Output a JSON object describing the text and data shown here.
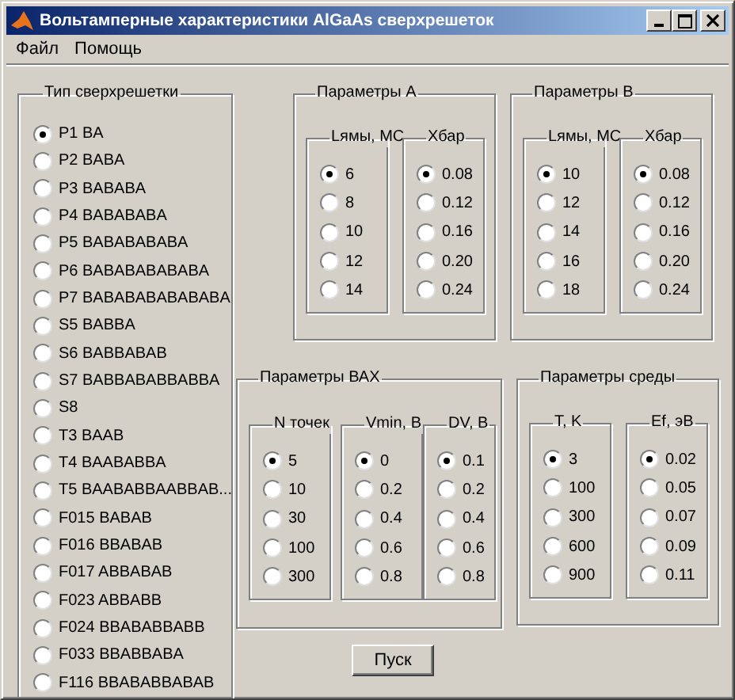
{
  "window": {
    "title": "Вольтамперные характеристики AlGaAs сверхрешеток"
  },
  "menu": [
    "Файл",
    "Помощь"
  ],
  "superlattice_type": {
    "title": "Тип сверхрешетки",
    "options": [
      {
        "label": "P1 BA",
        "selected": true
      },
      {
        "label": "P2 BABA",
        "selected": false
      },
      {
        "label": "P3 BABABA",
        "selected": false
      },
      {
        "label": "P4 BABABABA",
        "selected": false
      },
      {
        "label": "P5 BABABABABA",
        "selected": false
      },
      {
        "label": "P6 BABABABABABA",
        "selected": false
      },
      {
        "label": "P7 BABABABABABABA",
        "selected": false
      },
      {
        "label": "S5 BABBA",
        "selected": false
      },
      {
        "label": "S6 BABBABAB",
        "selected": false
      },
      {
        "label": "S7 BABBABABBABBA",
        "selected": false
      },
      {
        "label": "S8",
        "selected": false
      },
      {
        "label": "T3 BAAB",
        "selected": false
      },
      {
        "label": "T4 BAABABBA",
        "selected": false
      },
      {
        "label": "T5 BAABABBAABBAB...",
        "selected": false
      },
      {
        "label": "F015 BABAB",
        "selected": false
      },
      {
        "label": "F016 BBABAB",
        "selected": false
      },
      {
        "label": "F017 ABBABAB",
        "selected": false
      },
      {
        "label": "F023 ABBABB",
        "selected": false
      },
      {
        "label": "F024 BBABABBABB",
        "selected": false
      },
      {
        "label": "F033 BBABBABA",
        "selected": false
      },
      {
        "label": "F116 BBABABBABAB",
        "selected": false
      }
    ]
  },
  "groups": [
    {
      "title": "Параметры A",
      "columns": [
        {
          "title": "Lямы, MC",
          "options": [
            {
              "label": "6",
              "selected": true
            },
            {
              "label": "8",
              "selected": false
            },
            {
              "label": "10",
              "selected": false
            },
            {
              "label": "12",
              "selected": false
            },
            {
              "label": "14",
              "selected": false
            }
          ]
        },
        {
          "title": "Xбар",
          "options": [
            {
              "label": "0.08",
              "selected": true
            },
            {
              "label": "0.12",
              "selected": false
            },
            {
              "label": "0.16",
              "selected": false
            },
            {
              "label": "0.20",
              "selected": false
            },
            {
              "label": "0.24",
              "selected": false
            }
          ]
        }
      ]
    },
    {
      "title": "Параметры B",
      "columns": [
        {
          "title": "Lямы, MC",
          "options": [
            {
              "label": "10",
              "selected": true
            },
            {
              "label": "12",
              "selected": false
            },
            {
              "label": "14",
              "selected": false
            },
            {
              "label": "16",
              "selected": false
            },
            {
              "label": "18",
              "selected": false
            }
          ]
        },
        {
          "title": "Xбар",
          "options": [
            {
              "label": "0.08",
              "selected": true
            },
            {
              "label": "0.12",
              "selected": false
            },
            {
              "label": "0.16",
              "selected": false
            },
            {
              "label": "0.20",
              "selected": false
            },
            {
              "label": "0.24",
              "selected": false
            }
          ]
        }
      ]
    },
    {
      "title": "Параметры ВАХ",
      "columns": [
        {
          "title": "N точек",
          "options": [
            {
              "label": "5",
              "selected": true
            },
            {
              "label": "10",
              "selected": false
            },
            {
              "label": "30",
              "selected": false
            },
            {
              "label": "100",
              "selected": false
            },
            {
              "label": "300",
              "selected": false
            }
          ]
        },
        {
          "title": "Vmin, B",
          "options": [
            {
              "label": "0",
              "selected": true
            },
            {
              "label": "0.2",
              "selected": false
            },
            {
              "label": "0.4",
              "selected": false
            },
            {
              "label": "0.6",
              "selected": false
            },
            {
              "label": "0.8",
              "selected": false
            }
          ]
        },
        {
          "title": "DV, B",
          "options": [
            {
              "label": "0.1",
              "selected": true
            },
            {
              "label": "0.2",
              "selected": false
            },
            {
              "label": "0.4",
              "selected": false
            },
            {
              "label": "0.6",
              "selected": false
            },
            {
              "label": "0.8",
              "selected": false
            }
          ]
        }
      ]
    },
    {
      "title": "Параметры среды",
      "columns": [
        {
          "title": "T, K",
          "options": [
            {
              "label": "3",
              "selected": true
            },
            {
              "label": "100",
              "selected": false
            },
            {
              "label": "300",
              "selected": false
            },
            {
              "label": "600",
              "selected": false
            },
            {
              "label": "900",
              "selected": false
            }
          ]
        },
        {
          "title": "Ef, эВ",
          "options": [
            {
              "label": "0.02",
              "selected": true
            },
            {
              "label": "0.05",
              "selected": false
            },
            {
              "label": "0.07",
              "selected": false
            },
            {
              "label": "0.09",
              "selected": false
            },
            {
              "label": "0.11",
              "selected": false
            }
          ]
        }
      ]
    }
  ],
  "run_button": "Пуск"
}
